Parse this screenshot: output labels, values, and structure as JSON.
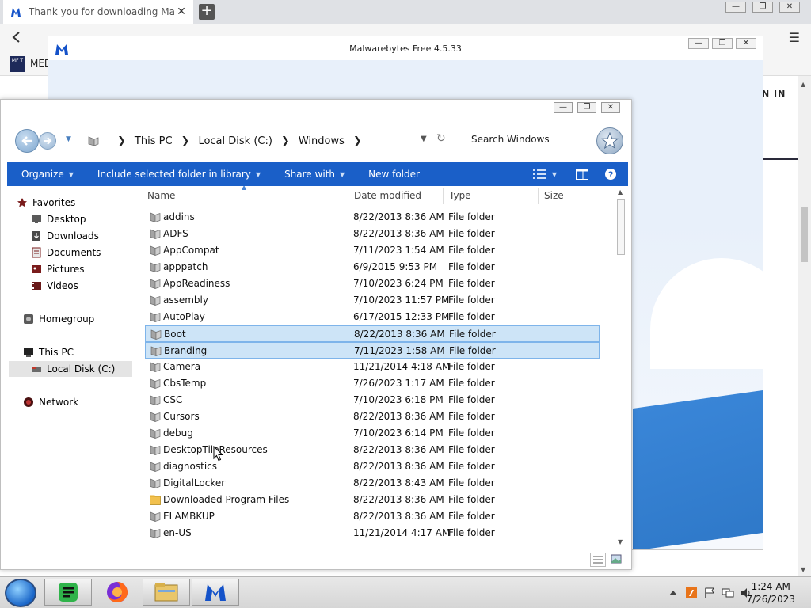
{
  "browser": {
    "tab_title": "Thank you for downloading Malwarebytes",
    "tab_close": "✕",
    "new_tab": "+",
    "win_min": "—",
    "win_max": "❐",
    "win_close": "✕",
    "menu": "☰",
    "bookmark_label": "MEDITORIAL",
    "bookmark_icon_text": "MF T",
    "page_text": "N IN"
  },
  "malwarebytes": {
    "title": "Malwarebytes Free  4.5.33",
    "win_min": "—",
    "win_max": "❐",
    "win_close": "✕"
  },
  "explorer": {
    "win_min": "—",
    "win_max": "❐",
    "win_close": "✕",
    "breadcrumb": [
      "This PC",
      "Local Disk (C:)",
      "Windows"
    ],
    "search_placeholder": "Search Windows",
    "toolbar": {
      "organize": "Organize",
      "include": "Include selected folder in library",
      "share": "Share with",
      "new_folder": "New folder"
    },
    "columns": {
      "name": "Name",
      "date": "Date modified",
      "type": "Type",
      "size": "Size"
    },
    "nav": {
      "favorites": "Favorites",
      "desktop": "Desktop",
      "downloads": "Downloads",
      "documents": "Documents",
      "pictures": "Pictures",
      "videos": "Videos",
      "homegroup": "Homegroup",
      "this_pc": "This PC",
      "local_disk": "Local Disk (C:)",
      "network": "Network"
    },
    "rows": [
      {
        "name": "addins",
        "date": "8/22/2013 8:36 AM",
        "type": "File folder"
      },
      {
        "name": "ADFS",
        "date": "8/22/2013 8:36 AM",
        "type": "File folder"
      },
      {
        "name": "AppCompat",
        "date": "7/11/2023 1:54 AM",
        "type": "File folder"
      },
      {
        "name": "apppatch",
        "date": "6/9/2015 9:53 PM",
        "type": "File folder"
      },
      {
        "name": "AppReadiness",
        "date": "7/10/2023 6:24 PM",
        "type": "File folder"
      },
      {
        "name": "assembly",
        "date": "7/10/2023 11:57 PM",
        "type": "File folder"
      },
      {
        "name": "AutoPlay",
        "date": "6/17/2015 12:33 PM",
        "type": "File folder"
      },
      {
        "name": "Boot",
        "date": "8/22/2013 8:36 AM",
        "type": "File folder"
      },
      {
        "name": "Branding",
        "date": "7/11/2023 1:58 AM",
        "type": "File folder"
      },
      {
        "name": "Camera",
        "date": "11/21/2014 4:18 AM",
        "type": "File folder"
      },
      {
        "name": "CbsTemp",
        "date": "7/26/2023 1:17 AM",
        "type": "File folder"
      },
      {
        "name": "CSC",
        "date": "7/10/2023 6:18 PM",
        "type": "File folder"
      },
      {
        "name": "Cursors",
        "date": "8/22/2013 8:36 AM",
        "type": "File folder"
      },
      {
        "name": "debug",
        "date": "7/10/2023 6:14 PM",
        "type": "File folder"
      },
      {
        "name": "DesktopTileResources",
        "date": "8/22/2013 8:36 AM",
        "type": "File folder"
      },
      {
        "name": "diagnostics",
        "date": "8/22/2013 8:36 AM",
        "type": "File folder"
      },
      {
        "name": "DigitalLocker",
        "date": "8/22/2013 8:43 AM",
        "type": "File folder"
      },
      {
        "name": "Downloaded Program Files",
        "date": "8/22/2013 8:36 AM",
        "type": "File folder"
      },
      {
        "name": "ELAMBKUP",
        "date": "8/22/2013 8:36 AM",
        "type": "File folder"
      },
      {
        "name": "en-US",
        "date": "11/21/2014 4:17 AM",
        "type": "File folder"
      }
    ],
    "selected_rows": [
      7,
      8
    ]
  },
  "taskbar": {
    "time": "1:24 AM",
    "date": "7/26/2023"
  },
  "colors": {
    "command_bar": "#1a5fc8",
    "selection": "#cde4f7",
    "folder": "#9a9a9a"
  }
}
